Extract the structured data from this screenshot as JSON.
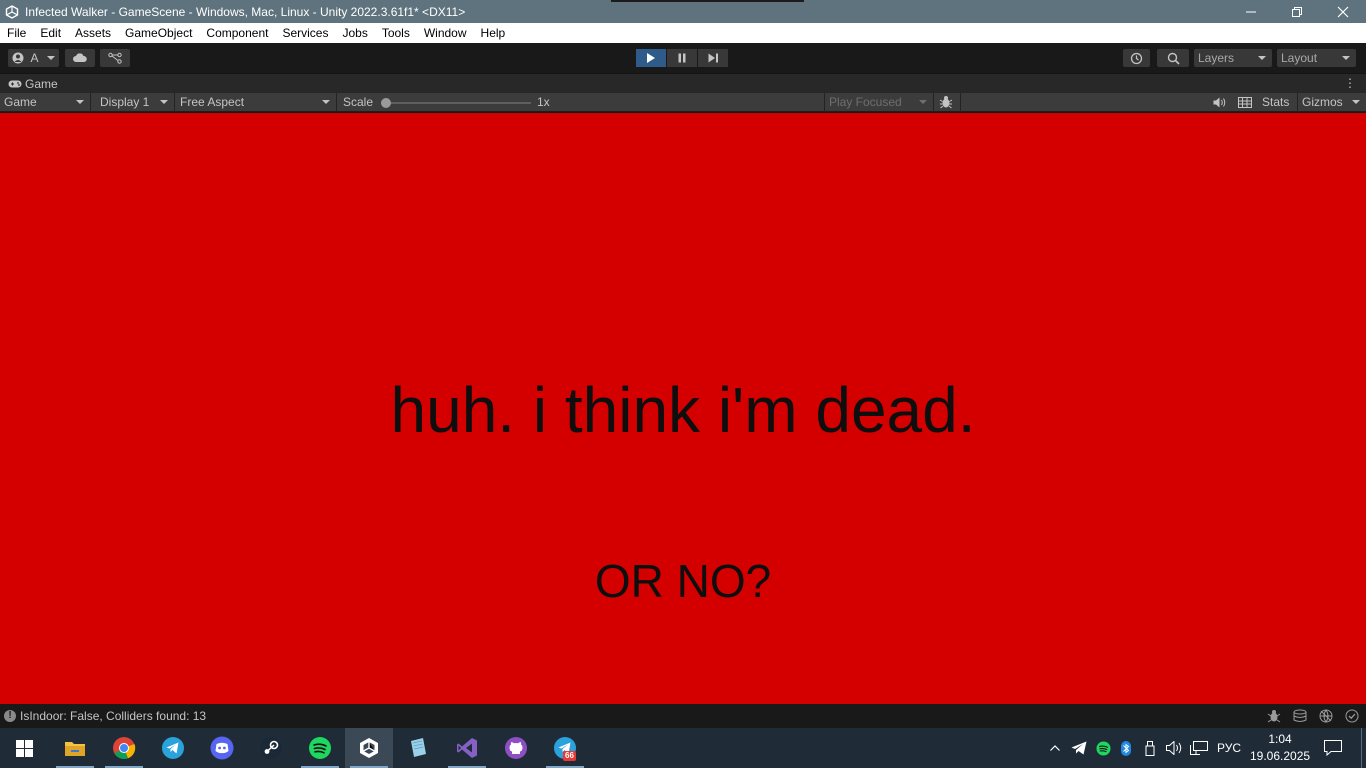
{
  "window": {
    "title": "Infected Walker - GameScene - Windows, Mac, Linux - Unity 2022.3.61f1* <DX11>",
    "controls": [
      "minimize",
      "maximize",
      "close"
    ]
  },
  "menu": [
    "File",
    "Edit",
    "Assets",
    "GameObject",
    "Component",
    "Services",
    "Jobs",
    "Tools",
    "Window",
    "Help"
  ],
  "toolbar": {
    "account_label": "A",
    "layers_label": "Layers",
    "layout_label": "Layout"
  },
  "game_tab": {
    "label": "Game"
  },
  "game_toolbar": {
    "view_select": "Game",
    "display_select": "Display 1",
    "aspect_select": "Free Aspect",
    "scale_label": "Scale",
    "scale_value": "1x",
    "play_mode": "Play Focused",
    "stats_label": "Stats",
    "gizmos_label": "Gizmos"
  },
  "game_view": {
    "background": "#d40000",
    "main_text": "huh. i think i'm dead.",
    "sub_text": "OR NO?"
  },
  "status": {
    "message": "IsIndoor: False, Colliders found: 13"
  },
  "taskbar": {
    "apps": [
      "start",
      "file-explorer",
      "chrome",
      "telegram",
      "discord",
      "steam",
      "spotify",
      "unity",
      "notes",
      "visual-studio",
      "github-desktop",
      "telegram-2"
    ],
    "telegram_badge": "66",
    "language": "РУС",
    "time": "1:04",
    "date": "19.06.2025"
  },
  "colors": {
    "accent_play": "#2e5b89",
    "titlebar": "#5f737e",
    "taskbar": "#1f2c38"
  }
}
